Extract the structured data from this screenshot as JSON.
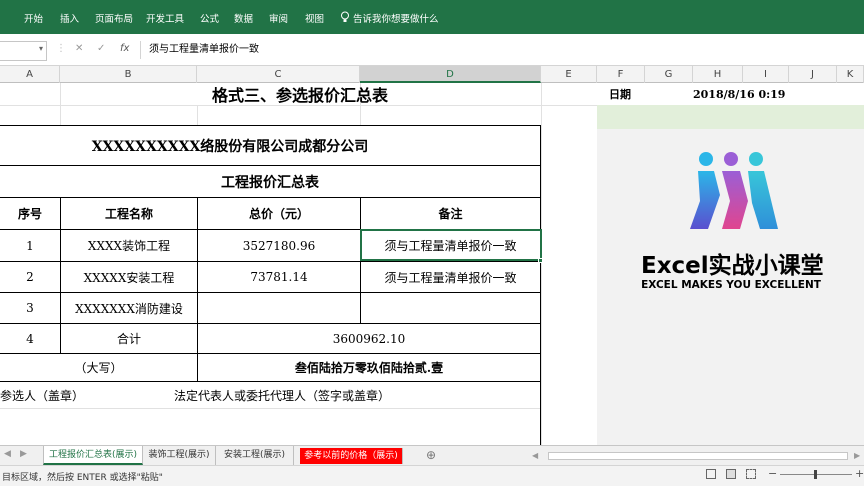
{
  "ribbon": {
    "tabs": [
      "开始",
      "插入",
      "页面布局",
      "开发工具",
      "公式",
      "数据",
      "审阅",
      "视图"
    ],
    "tell_me": "告诉我你想要做什么",
    "accent": "#217346"
  },
  "formula_bar": {
    "cancel": "✕",
    "enter": "✓",
    "fx": "fx",
    "value": "须与工程量清单报价一致"
  },
  "columns": [
    "A",
    "B",
    "C",
    "D",
    "E",
    "F",
    "G",
    "H",
    "I",
    "J",
    "K"
  ],
  "sheet": {
    "title": "格式三、参选报价汇总表",
    "company": "XXXXXXXXXX络股份有限公司成都分公司",
    "subtitle": "工程报价汇总表",
    "headers": [
      "序号",
      "工程名称",
      "总价（元）",
      "备注"
    ],
    "rows": [
      {
        "no": "1",
        "name": "XXXX装饰工程",
        "price": "3527180.96",
        "note": "须与工程量清单报价一致"
      },
      {
        "no": "2",
        "name": "XXXXX安装工程",
        "price": "73781.14",
        "note": "须与工程量清单报价一致"
      },
      {
        "no": "3",
        "name": "XXXXXXX消防建设",
        "price": "",
        "note": ""
      }
    ],
    "total_no": "4",
    "total_label": "合计",
    "total_value": "3600962.10",
    "daxie_label": "（大写）",
    "daxie_value": "叁佰陆拾万零玖佰陆拾贰.壹",
    "sign_left": "参选人（盖章）",
    "sign_right": "法定代表人或委托代理人（签字或盖章）"
  },
  "side": {
    "date_label": "日期",
    "date_value": "2018/8/16  0:19"
  },
  "logo": {
    "brand": "Excel实战小课堂",
    "slogan": "EXCEL MAKES YOU EXCELLENT"
  },
  "sheet_tabs": [
    {
      "label": "工程报价汇总表(展示)",
      "active": true
    },
    {
      "label": "装饰工程(展示)",
      "active": false
    },
    {
      "label": "安装工程(展示)",
      "active": false
    },
    {
      "label": "参考以前的价格（展示)",
      "active": false,
      "color": "#ff0000"
    }
  ],
  "add_sheet": "⊕",
  "status_text": "目标区域，然后按 ENTER 或选择\"粘贴\""
}
